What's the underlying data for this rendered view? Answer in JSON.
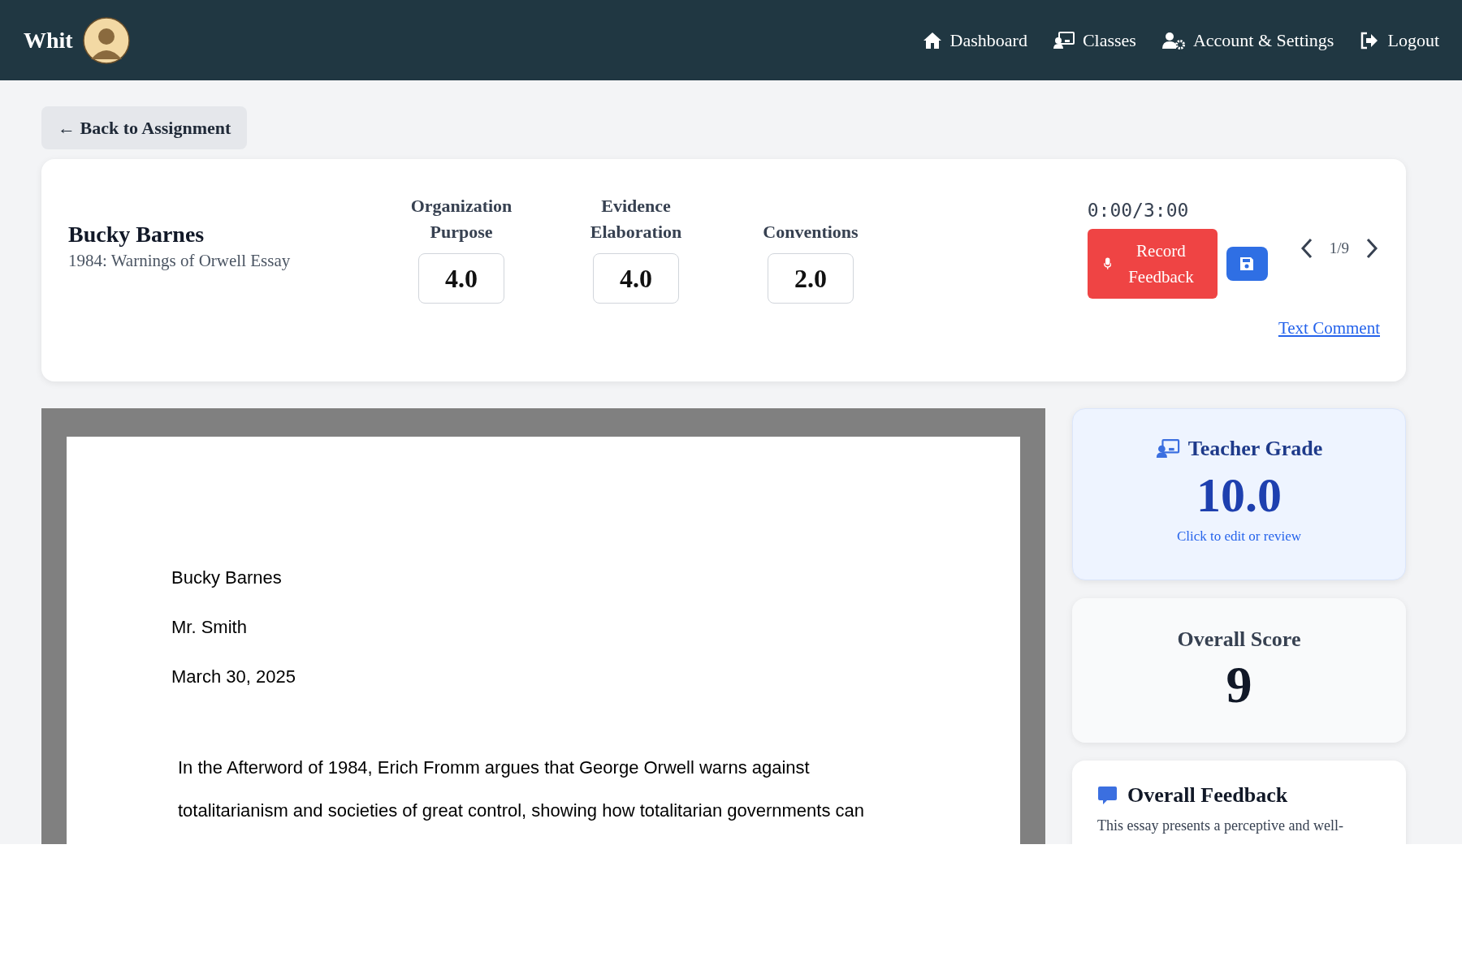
{
  "nav": {
    "brand": "Whit",
    "links": [
      {
        "label": "Dashboard",
        "kind": "dashboard"
      },
      {
        "label": "Classes",
        "kind": "classes"
      },
      {
        "label": "Account & Settings",
        "kind": "account"
      },
      {
        "label": "Logout",
        "kind": "logout"
      }
    ]
  },
  "back_button": "← Back to Assignment",
  "student": {
    "name": "Bucky Barnes",
    "assignment": "1984: Warnings of Orwell Essay"
  },
  "scores": [
    {
      "label": "Organization Purpose",
      "value": "4.0"
    },
    {
      "label": "Evidence Elaboration",
      "value": "4.0"
    },
    {
      "label": "Conventions",
      "value": "2.0"
    }
  ],
  "recorder": {
    "timer": "0:00/3:00",
    "record_label": "Record Feedback",
    "text_comment": "Text Comment"
  },
  "pager": {
    "position": "1/9"
  },
  "document": {
    "header_lines": [
      "Bucky Barnes",
      "Mr. Smith",
      "March 30, 2025"
    ],
    "body_lines": [
      "In the Afterword of 1984, Erich Fromm argues that George Orwell warns against",
      "totalitarianism and societies of great control, showing how totalitarian governments can"
    ]
  },
  "teacher_grade": {
    "title": "Teacher Grade",
    "value": "10.0",
    "hint": "Click to edit or review"
  },
  "overall_score": {
    "title": "Overall Score",
    "value": "9"
  },
  "overall_feedback": {
    "title": "Overall Feedback",
    "text": "This essay presents a perceptive and well-"
  }
}
